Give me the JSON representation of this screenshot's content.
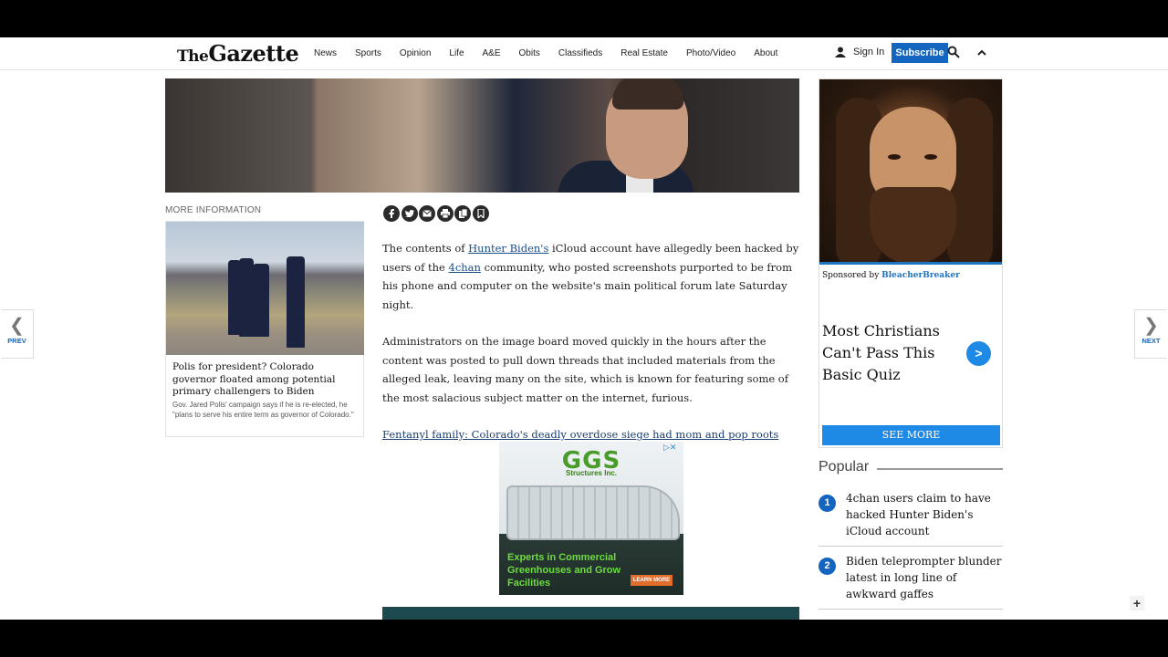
{
  "header": {
    "logo": "The Gazette",
    "logo_the": "The",
    "logo_main": "Gazette",
    "nav": [
      "News",
      "Sports",
      "Opinion",
      "Life",
      "A&E",
      "Obits",
      "Classifieds",
      "Real Estate",
      "Photo/Video",
      "About"
    ],
    "sign_in": "Sign In",
    "subscribe": "Subscribe"
  },
  "sidebar_left": {
    "label": "MORE INFORMATION",
    "related": {
      "title": "Polis for president? Colorado governor floated among potential primary challengers to Biden",
      "description": "Gov. Jared Polis' campaign says if he is re-elected, he \"plans to serve his entire term as governor of Colorado.\""
    }
  },
  "article": {
    "p1_before": "The contents of ",
    "p1_link1": "Hunter Biden's",
    "p1_mid": " iCloud account have allegedly been hacked by users of the ",
    "p1_link2": "4chan",
    "p1_after": " community, who posted screenshots purported to be from his phone and computer on the website's main political forum late Saturday night.",
    "p2": "Administrators on the image board moved quickly in the hours after the content was posted to pull down threads that included materials from the alleged leak, leaving many on the site, which is known for featuring some of the most salacious subject matter on the internet, furious.",
    "related_link": "Fentanyl family: Colorado's deadly overdose siege had mom and pop roots"
  },
  "share_icons": [
    "facebook-icon",
    "twitter-icon",
    "email-icon",
    "print-icon",
    "copy-icon",
    "bookmark-icon"
  ],
  "ad_ggs": {
    "logo": "GGS",
    "subtitle": "Structures Inc.",
    "headline": "Experts in Commercial Greenhouses and Grow Facilities",
    "cta": "LEARN MORE"
  },
  "sponsor": {
    "sponsored_by_prefix": "Sponsored by",
    "sponsor_name": "BleacherBreaker",
    "title": "Most Christians Can't Pass This Basic Quiz",
    "arrow": ">",
    "button": "SEE MORE"
  },
  "popular": {
    "label": "Popular",
    "items": [
      {
        "num": "1",
        "title": "4chan users claim to have hacked Hunter Biden's iCloud account"
      },
      {
        "num": "2",
        "title": "Biden teleprompter blunder latest in long line of awkward gaffes"
      }
    ]
  },
  "pager": {
    "prev": "PREV",
    "next": "NEXT"
  },
  "colors": {
    "brand_blue": "#1465c0",
    "link": "#1a4e8a",
    "ad_green": "#4a9c2a"
  }
}
